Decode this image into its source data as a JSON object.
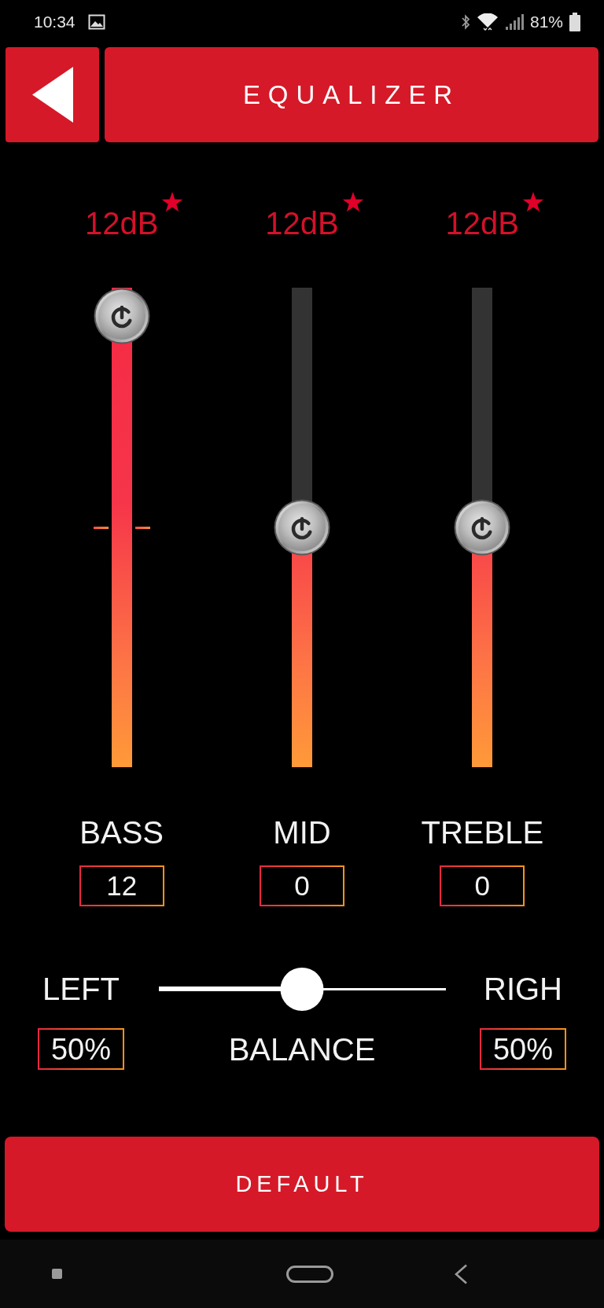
{
  "status_bar": {
    "time": "10:34",
    "battery": "81%"
  },
  "header": {
    "title": "EQUALIZER"
  },
  "sliders": [
    {
      "reading": "12dB",
      "label": "BASS",
      "value": "12",
      "level": 1
    },
    {
      "reading": "12dB",
      "label": "MID",
      "value": "0",
      "level": 0.5
    },
    {
      "reading": "12dB",
      "label": "TREBLE",
      "value": "0",
      "level": 0.5
    }
  ],
  "balance": {
    "left_label": "LEFT",
    "right_label": "RIGH",
    "title": "BALANCE",
    "left_value": "50%",
    "right_value": "50%",
    "level": 0.5
  },
  "default_button": {
    "label": "DEFAULT"
  }
}
